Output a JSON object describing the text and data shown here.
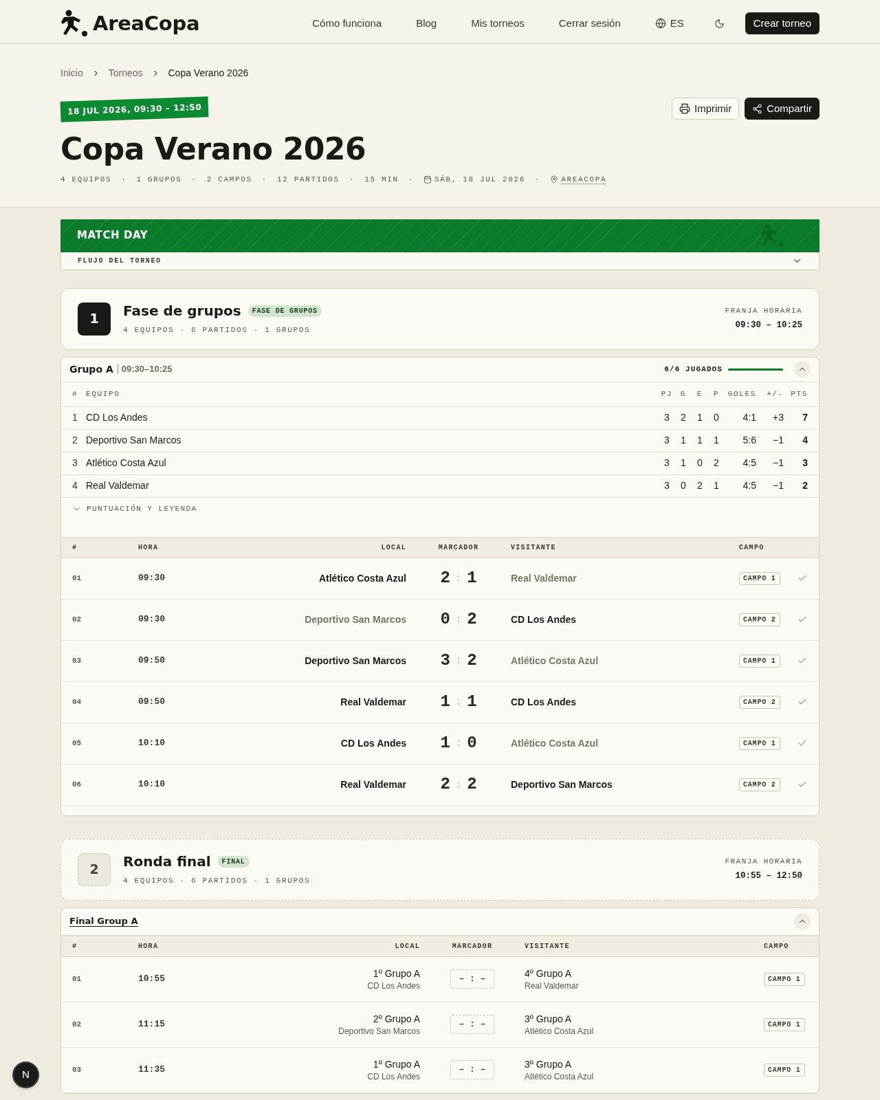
{
  "header": {
    "logo_text": "AreaCopa",
    "nav": [
      {
        "label": "Cómo funciona"
      },
      {
        "label": "Blog"
      },
      {
        "label": "Mis torneos"
      },
      {
        "label": "Cerrar sesión"
      }
    ],
    "language": "ES",
    "cta": "Crear torneo"
  },
  "breadcrumb": [
    {
      "label": "Inicio",
      "current": false
    },
    {
      "label": "Torneos",
      "current": false
    },
    {
      "label": "Copa Verano 2026",
      "current": true
    }
  ],
  "hero": {
    "date_badge": "18 JUL 2026, 09:30 – 12:50",
    "title": "Copa Verano 2026",
    "actions": [
      {
        "kind": "print",
        "label": "Imprimir",
        "primary": false
      },
      {
        "kind": "share",
        "label": "Compartir",
        "primary": true
      }
    ],
    "meta": {
      "separator": "·",
      "items": [
        {
          "kind": "plain",
          "text": "4 EQUIPOS"
        },
        {
          "kind": "plain",
          "text": "1 GRUPOS"
        },
        {
          "kind": "plain",
          "text": "2 CAMPOS"
        },
        {
          "kind": "plain",
          "text": "12 PARTIDOS"
        },
        {
          "kind": "plain",
          "text": "15 MIN"
        },
        {
          "kind": "date",
          "text": "SÁB, 18 JUL 2026"
        },
        {
          "kind": "location",
          "text": "AREACOPA"
        }
      ]
    }
  },
  "match_day": {
    "title": "MATCH DAY",
    "flow_label": "FLUJO DEL TORNEO",
    "expanded": false
  },
  "phases": [
    {
      "number": "1",
      "title": "Fase de grupos",
      "tag": "FASE DE GRUPOS",
      "meta": "4 EQUIPOS · 6 PARTIDOS · 1 GRUPOS",
      "slot_label": "FRANJA HORARIA",
      "slot": "09:30 – 10:25",
      "active": true,
      "groups": [
        {
          "kind": "standings",
          "title": "Grupo A",
          "time": "09:30–10:25",
          "progress_label": "6/6 JUGADOS",
          "level": 1,
          "expanded": true,
          "standings": {
            "columns": [
              "#",
              "EQUIPO",
              "PJ",
              "G",
              "E",
              "P",
              "GOLES",
              "+/-",
              "PTS"
            ],
            "rows": [
              [
                "1",
                "CD Los Andes",
                "3",
                "2",
                "1",
                "0",
                "4:1",
                "+3",
                "7"
              ],
              [
                "2",
                "Deportivo San Marcos",
                "3",
                "1",
                "1",
                "1",
                "5:6",
                "−1",
                "4"
              ],
              [
                "3",
                "Atlético Costa Azul",
                "3",
                "1",
                "0",
                "2",
                "4:5",
                "−1",
                "3"
              ],
              [
                "4",
                "Real Valdemar",
                "3",
                "0",
                "2",
                "1",
                "4:5",
                "−1",
                "2"
              ]
            ]
          },
          "legend": {
            "label": "PUNTUACIÓN Y LEYENDA",
            "expanded": false
          },
          "matches": {
            "columns": [
              "#",
              "HORA",
              "LOCAL",
              "MARCADOR",
              "VISITANTE",
              "CAMPO"
            ],
            "score_separator": ":",
            "rows": [
              {
                "number": "01",
                "time": "09:30",
                "home": {
                  "name": "Atlético Costa Azul",
                  "dimmed": false
                },
                "home_score": "2",
                "away_score": "1",
                "away": {
                  "name": "Real Valdemar",
                  "dimmed": true
                },
                "field": "CAMPO 1",
                "completed": true
              },
              {
                "number": "02",
                "time": "09:30",
                "home": {
                  "name": "Deportivo San Marcos",
                  "dimmed": true
                },
                "home_score": "0",
                "away_score": "2",
                "away": {
                  "name": "CD Los Andes",
                  "dimmed": false
                },
                "field": "CAMPO 2",
                "completed": true
              },
              {
                "number": "03",
                "time": "09:50",
                "home": {
                  "name": "Deportivo San Marcos",
                  "dimmed": false
                },
                "home_score": "3",
                "away_score": "2",
                "away": {
                  "name": "Atlético Costa Azul",
                  "dimmed": true
                },
                "field": "CAMPO 1",
                "completed": true
              },
              {
                "number": "04",
                "time": "09:50",
                "home": {
                  "name": "Real Valdemar",
                  "dimmed": false
                },
                "home_score": "1",
                "away_score": "1",
                "away": {
                  "name": "CD Los Andes",
                  "dimmed": false
                },
                "field": "CAMPO 2",
                "completed": true
              },
              {
                "number": "05",
                "time": "10:10",
                "home": {
                  "name": "CD Los Andes",
                  "dimmed": false
                },
                "home_score": "1",
                "away_score": "0",
                "away": {
                  "name": "Atlético Costa Azul",
                  "dimmed": true
                },
                "field": "CAMPO 1",
                "completed": true
              },
              {
                "number": "06",
                "time": "10:10",
                "home": {
                  "name": "Real Valdemar",
                  "dimmed": false
                },
                "home_score": "2",
                "away_score": "2",
                "away": {
                  "name": "Deportivo San Marcos",
                  "dimmed": false
                },
                "field": "CAMPO 2",
                "completed": true
              }
            ]
          }
        }
      ]
    },
    {
      "number": "2",
      "title": "Ronda final",
      "tag": "FINAL",
      "meta": "4 EQUIPOS · 6 PARTIDOS · 1 GRUPOS",
      "slot_label": "FRANJA HORARIA",
      "slot": "10:55 – 12:50",
      "active": false,
      "groups": [
        {
          "kind": "bracket",
          "title": "Final Group A",
          "expanded": true,
          "matches": {
            "columns": [
              "#",
              "HORA",
              "LOCAL",
              "MARCADOR",
              "VISITANTE",
              "CAMPO"
            ],
            "score_separator": ":",
            "rows": [
              {
                "number": "01",
                "time": "10:55",
                "home": {
                  "seed": "1º Grupo A",
                  "name": "CD Los Andes"
                },
                "home_score": "–",
                "away_score": "–",
                "away": {
                  "seed": "4º Grupo A",
                  "name": "Real Valdemar"
                },
                "field": "CAMPO 1"
              },
              {
                "number": "02",
                "time": "11:15",
                "home": {
                  "seed": "2º Grupo A",
                  "name": "Deportivo San Marcos"
                },
                "home_score": "–",
                "away_score": "–",
                "away": {
                  "seed": "3º Grupo A",
                  "name": "Atlético Costa Azul"
                },
                "field": "CAMPO 1"
              },
              {
                "number": "03",
                "time": "11:35",
                "home": {
                  "seed": "1º Grupo A",
                  "name": "CD Los Andes"
                },
                "home_score": "–",
                "away_score": "–",
                "away": {
                  "seed": "3º Grupo A",
                  "name": "Atlético Costa Azul"
                },
                "field": "CAMPO 1"
              }
            ]
          }
        }
      ]
    }
  ],
  "dev_indicator": {
    "label": "N"
  }
}
